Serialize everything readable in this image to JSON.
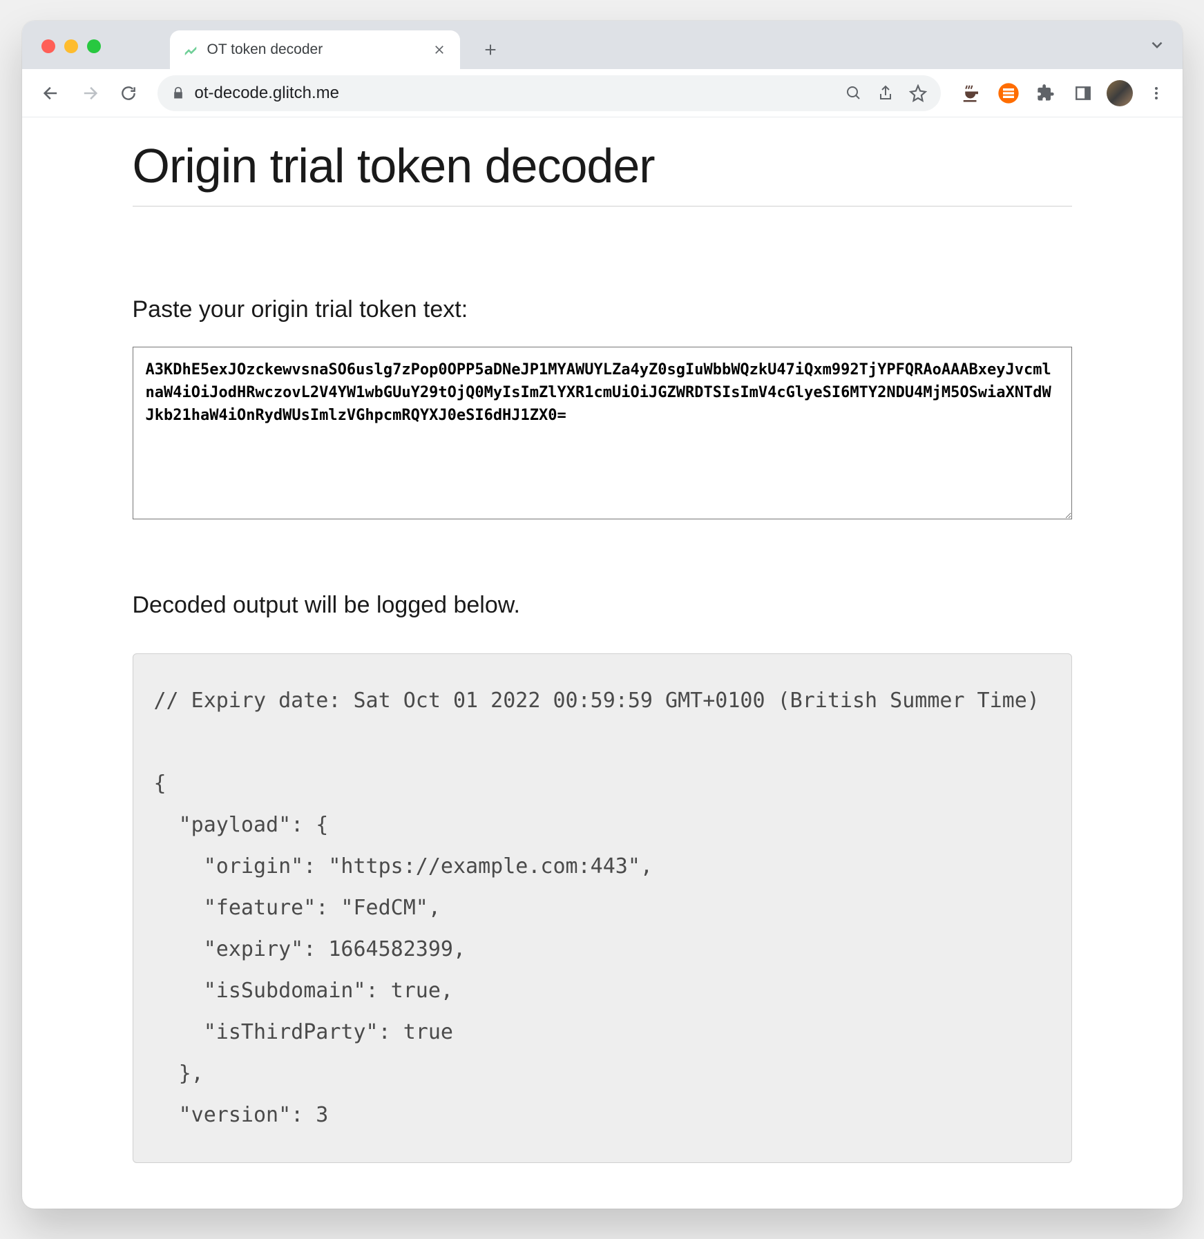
{
  "browser": {
    "tab": {
      "title": "OT token decoder",
      "favicon_color": "#6fcf97"
    },
    "url": "ot-decode.glitch.me",
    "extensions": {
      "coffee_color": "#6d4c41",
      "orange_badge_color": "#ff6d00"
    }
  },
  "page": {
    "heading": "Origin trial token decoder",
    "input_label": "Paste your origin trial token text:",
    "token_value": "A3KDhE5exJOzckewvsnaSO6uslg7zPop0OPP5aDNeJP1MYAWUYLZa4yZ0sgIuWbbWQzkU47iQxm992TjYPFQRAoAAABxeyJvcmlnaW4iOiJodHRwczovL2V4YW1wbGUuY29tOjQ0MyIsImZlYXR1cmUiOiJGZWRDTSIsImV4cGlyeSI6MTY2NDU4MjM5OSwiaXNTdWJkb21haW4iOnRydWUsImlzVGhpcmRQYXJ0eSI6dHJ1ZX0=",
    "output_label": "Decoded output will be logged below.",
    "decoded_comment": "// Expiry date: Sat Oct 01 2022 00:59:59 GMT+0100 (British Summer Time)",
    "decoded": {
      "payload": {
        "origin": "https://example.com:443",
        "feature": "FedCM",
        "expiry": 1664582399,
        "isSubdomain": true,
        "isThirdParty": true
      },
      "version": 3
    }
  }
}
